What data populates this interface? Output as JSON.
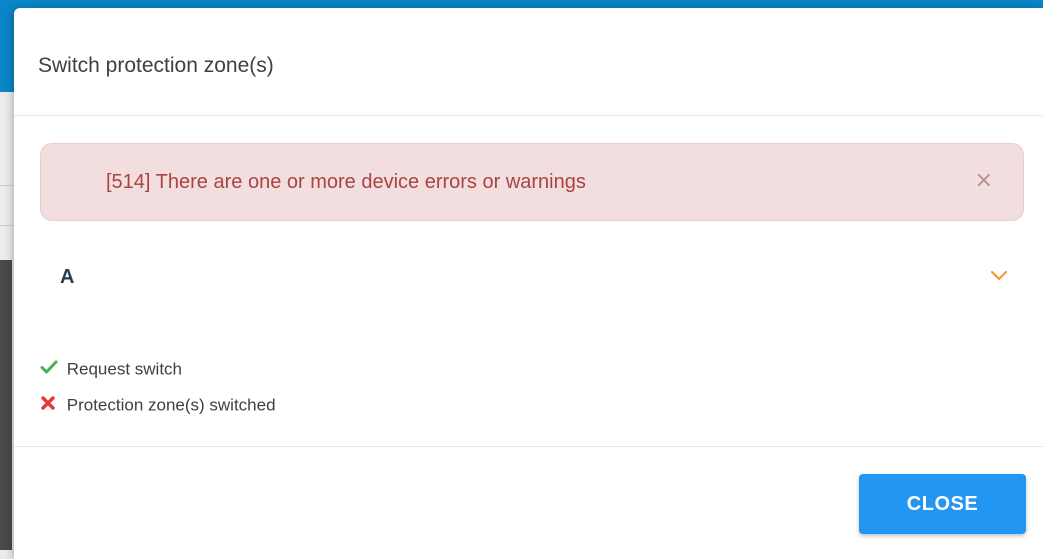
{
  "dialog": {
    "title": "Switch protection zone(s)",
    "close_label": "CLOSE"
  },
  "alert": {
    "message": "[514] There are one or more device errors or warnings",
    "dismiss_glyph": "×",
    "background_color": "#f2dede",
    "text_color": "#a94442"
  },
  "zone": {
    "name": "A",
    "expand_icon": "chevron-down-icon",
    "accent_color": "#f39c34"
  },
  "steps": [
    {
      "label": "Request switch",
      "status": "success",
      "icon": "check-icon",
      "color": "#4caf50"
    },
    {
      "label": "Protection zone(s) switched",
      "status": "failed",
      "icon": "cross-icon",
      "color": "#e53935"
    }
  ],
  "colors": {
    "primary_button": "#2196f3",
    "header_bar": "#0a86c8"
  }
}
